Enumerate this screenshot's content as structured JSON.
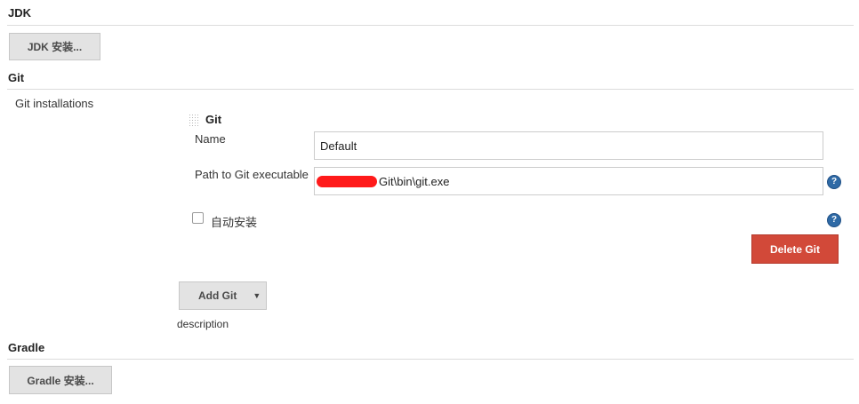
{
  "jdk": {
    "title": "JDK",
    "install_button": "JDK 安装..."
  },
  "git": {
    "title": "Git",
    "installations_label": "Git installations",
    "item_title": "Git",
    "name_label": "Name",
    "name_value": "Default",
    "path_label": "Path to Git executable",
    "path_value": "Git\\bin\\git.exe",
    "auto_install_label": "自动安装",
    "auto_install_checked": false,
    "delete_button": "Delete Git",
    "add_button": "Add Git",
    "description": "description",
    "help_icon": "question-mark-icon"
  },
  "gradle": {
    "title": "Gradle",
    "install_button": "Gradle 安装..."
  },
  "colors": {
    "danger": "#d24939",
    "help": "#2f6aa6",
    "button_bg": "#e3e3e3"
  }
}
